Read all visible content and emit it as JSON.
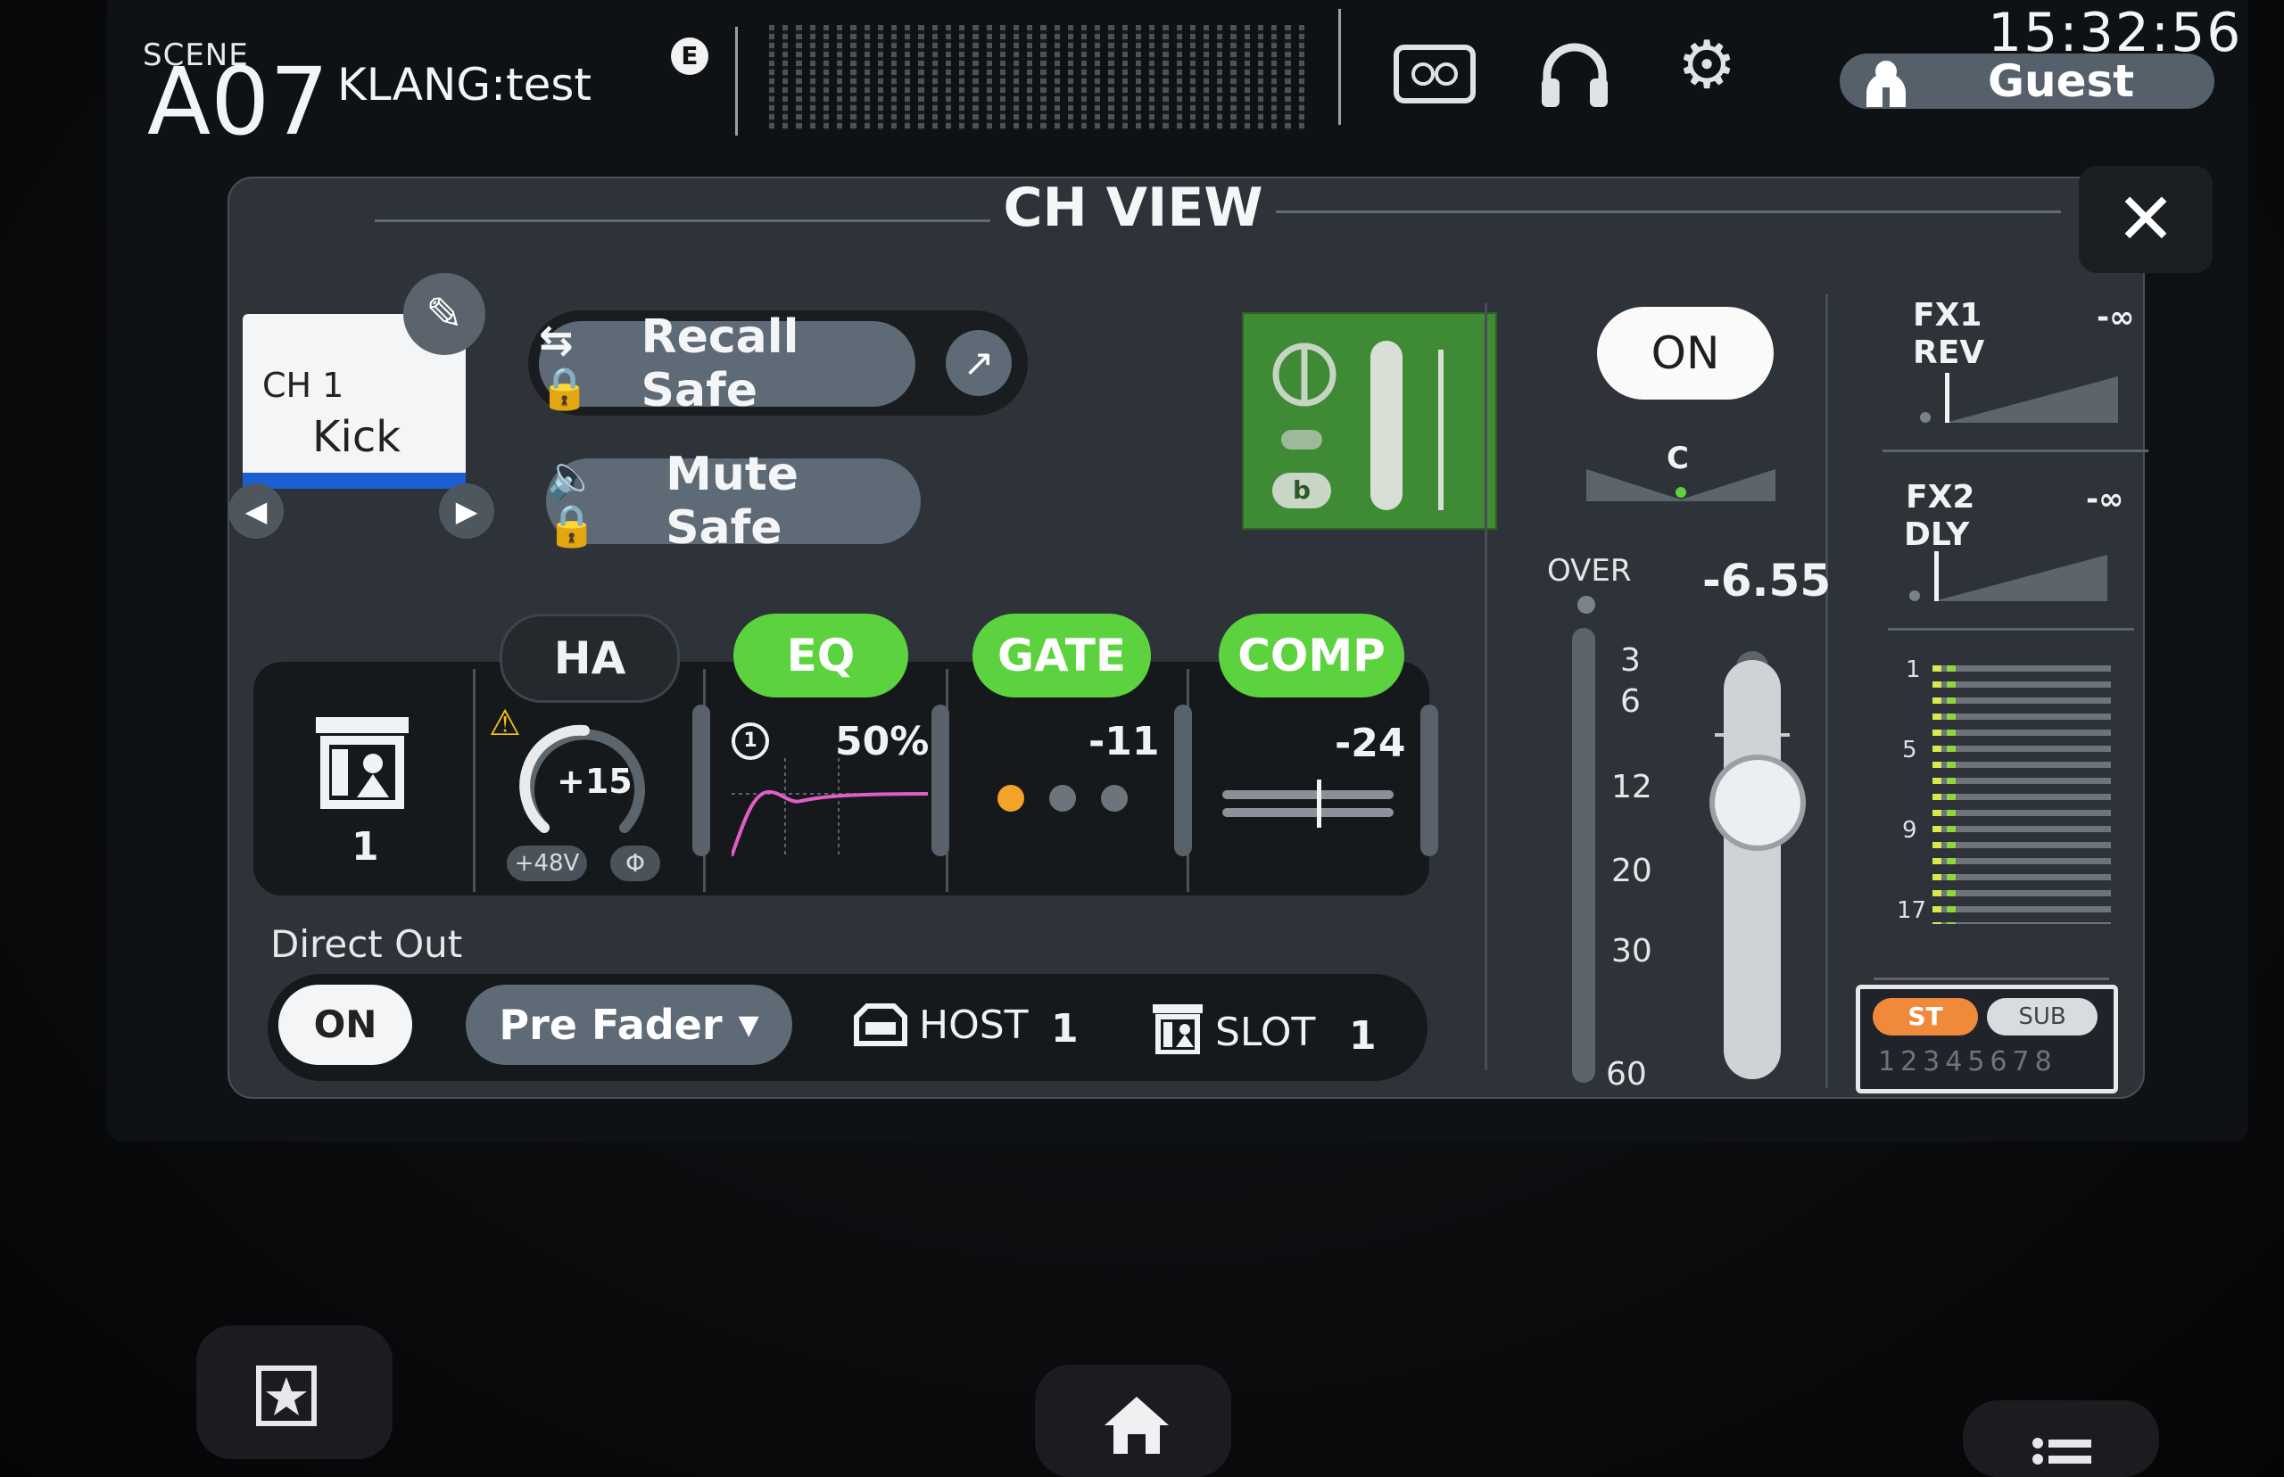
{
  "topbar": {
    "scene_label": "SCENE",
    "scene_number": "A07",
    "scene_name": "KLANG:test",
    "edit_badge": "E",
    "clock": "15:32:56",
    "user": "Guest"
  },
  "panel": {
    "title": "CH VIEW",
    "close_symbol": "✕"
  },
  "channel": {
    "number_label": "CH 1",
    "name": "Kick",
    "color": "#1b5fd3"
  },
  "safe": {
    "recall_label": "Recall Safe",
    "mute_label": "Mute Safe"
  },
  "io": {
    "b_label": "b"
  },
  "processing": {
    "input_number": "1",
    "tabs": {
      "ha": "HA",
      "eq": "EQ",
      "gate": "GATE",
      "comp": "COMP"
    },
    "ha_gain": "+15",
    "phantom_label": "+48V",
    "phase_label": "Φ",
    "eq_value": "50%",
    "eq_band": "1",
    "gate_value": "-11",
    "comp_value": "-24",
    "accent_color": "#5bd23e"
  },
  "direct_out": {
    "label": "Direct Out",
    "on_label": "ON",
    "point": "Pre Fader",
    "host_label": "HOST",
    "host_value": "1",
    "slot_label": "SLOT",
    "slot_value": "1"
  },
  "fader": {
    "on_label": "ON",
    "pan_label": "C",
    "level": "-6.55",
    "over_label": "OVER",
    "scale": [
      "3",
      "6",
      "12",
      "20",
      "30",
      "60"
    ]
  },
  "sends": {
    "fx1_name": "FX1",
    "fx1_type": "REV",
    "fx1_level": "-∞",
    "fx2_name": "FX2",
    "fx2_type": "DLY",
    "fx2_level": "-∞",
    "mix_numbers": [
      "1",
      "5",
      "9",
      "17"
    ],
    "st_label": "ST",
    "sub_label": "SUB",
    "matrix_label": "12345678"
  }
}
